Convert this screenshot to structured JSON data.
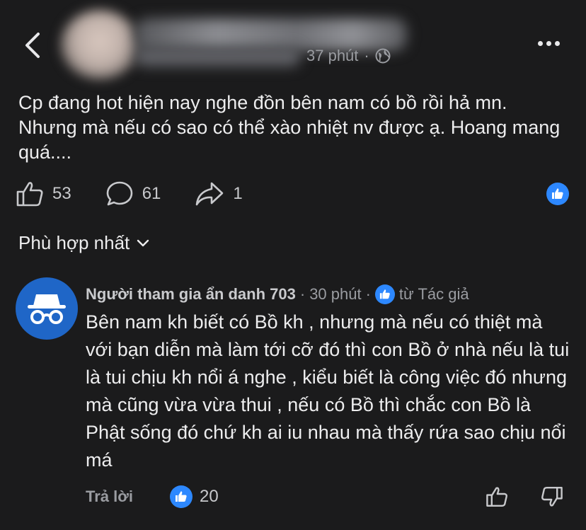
{
  "header": {
    "time": "37 phút",
    "time_sep": "·",
    "audience_icon": "globe-icon",
    "back_icon": "chevron-left-icon",
    "more_icon": "more-horizontal-icon"
  },
  "post": {
    "text": "Cp đang hot hiện nay nghe đồn bên nam có bồ rồi hả mn. Nhưng mà nếu có sao có thể xào nhiệt nv được ạ. Hoang mang quá....",
    "likes": "53",
    "comments": "61",
    "shares": "1"
  },
  "sort": {
    "label": "Phù hợp nhất"
  },
  "comment": {
    "author": "Người tham gia ẩn danh 703",
    "sep1": "·",
    "time": "30 phút",
    "sep2": "·",
    "from_author": "từ Tác giả",
    "text": "Bên nam kh biết có Bồ kh , nhưng mà nếu có thiệt mà với bạn diễn mà làm tới cỡ đó thì con Bồ ở nhà nếu là tui là tui chịu kh nổi á nghe , kiểu biết là công việc đó nhưng mà cũng vừa vừa thui , nếu có Bồ thì chắc con Bồ là Phật sống đó chứ kh ai iu nhau mà thấy rứa sao chịu nổi má",
    "reply_label": "Trả lời",
    "likes": "20"
  },
  "colors": {
    "background": "#1b1b1c",
    "accent": "#2d88ff",
    "anon_avatar": "#1f66c7"
  }
}
